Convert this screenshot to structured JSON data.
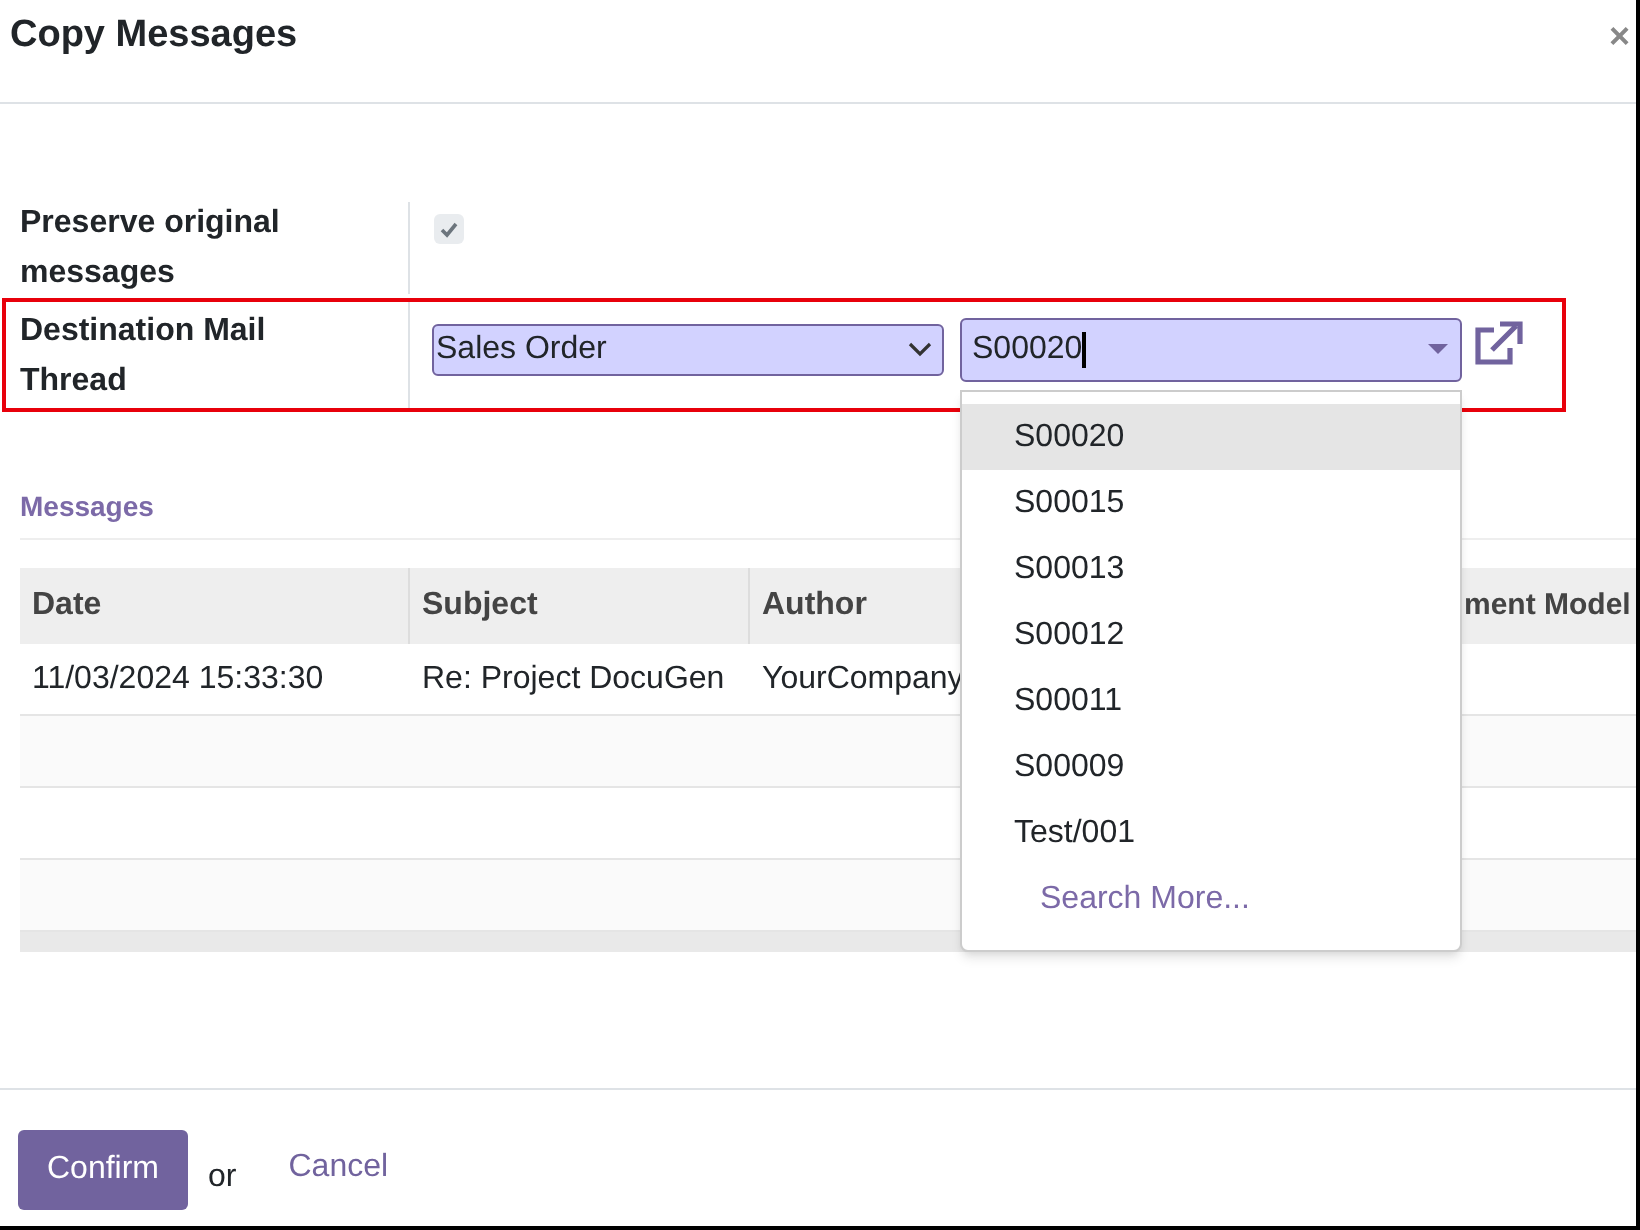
{
  "dialog": {
    "title": "Copy Messages",
    "close": "×"
  },
  "fields": [
    {
      "kind": "checkbox",
      "label": "Preserve original messages",
      "checked": true
    },
    {
      "kind": "reference",
      "label": "Destination Mail Thread",
      "model": "Sales Order",
      "record": "S00020",
      "highlighted": true
    }
  ],
  "dropdown": {
    "options": [
      {
        "label": "S00020",
        "selected": true
      },
      {
        "label": "S00015",
        "selected": false
      },
      {
        "label": "S00013",
        "selected": false
      },
      {
        "label": "S00012",
        "selected": false
      },
      {
        "label": "S00011",
        "selected": false
      },
      {
        "label": "S00009",
        "selected": false
      },
      {
        "label": "Test/001",
        "selected": false
      }
    ],
    "search_more": "Search More..."
  },
  "messages": {
    "title": "Messages",
    "columns": [
      "Date",
      "Subject",
      "Author",
      "ment Model"
    ],
    "rows": [
      [
        "11/03/2024 15:33:30",
        "Re: Project DocuGen",
        "YourCompany"
      ]
    ]
  },
  "footer": {
    "confirm": "Confirm",
    "or": "or",
    "cancel": "Cancel"
  }
}
